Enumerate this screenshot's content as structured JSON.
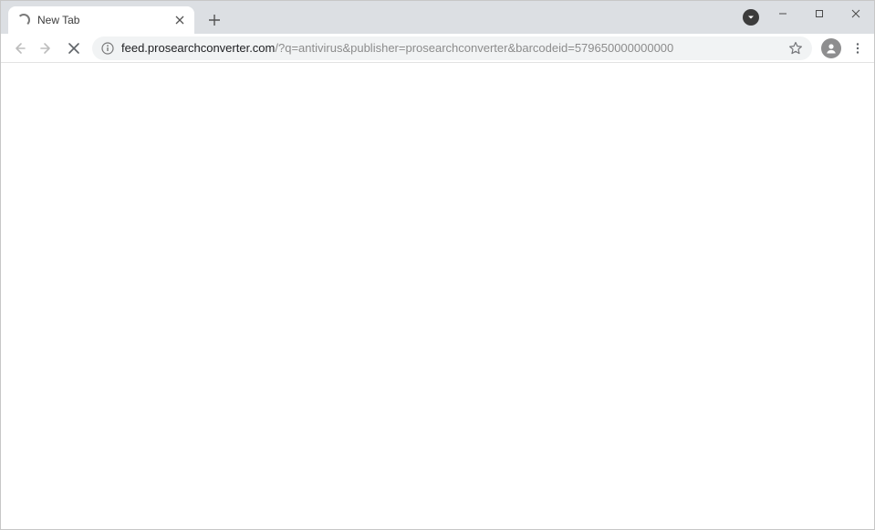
{
  "window": {
    "minimize_tooltip": "Minimize",
    "maximize_tooltip": "Maximize",
    "close_tooltip": "Close"
  },
  "tabstrip": {
    "tabs": [
      {
        "title": "New Tab",
        "loading": true
      }
    ],
    "newtab_tooltip": "New tab"
  },
  "toolbar": {
    "back_tooltip": "Back",
    "forward_tooltip": "Forward",
    "stop_tooltip": "Stop loading this page",
    "site_info_tooltip": "View site information",
    "bookmark_tooltip": "Bookmark this tab",
    "profile_tooltip": "You",
    "menu_tooltip": "Customize and control"
  },
  "omnibox": {
    "host": "feed.prosearchconverter.com",
    "path": "/?q=antivirus&publisher=prosearchconverter&barcodeid=579650000000000"
  },
  "extension_badge": {
    "tooltip": "Extension"
  }
}
